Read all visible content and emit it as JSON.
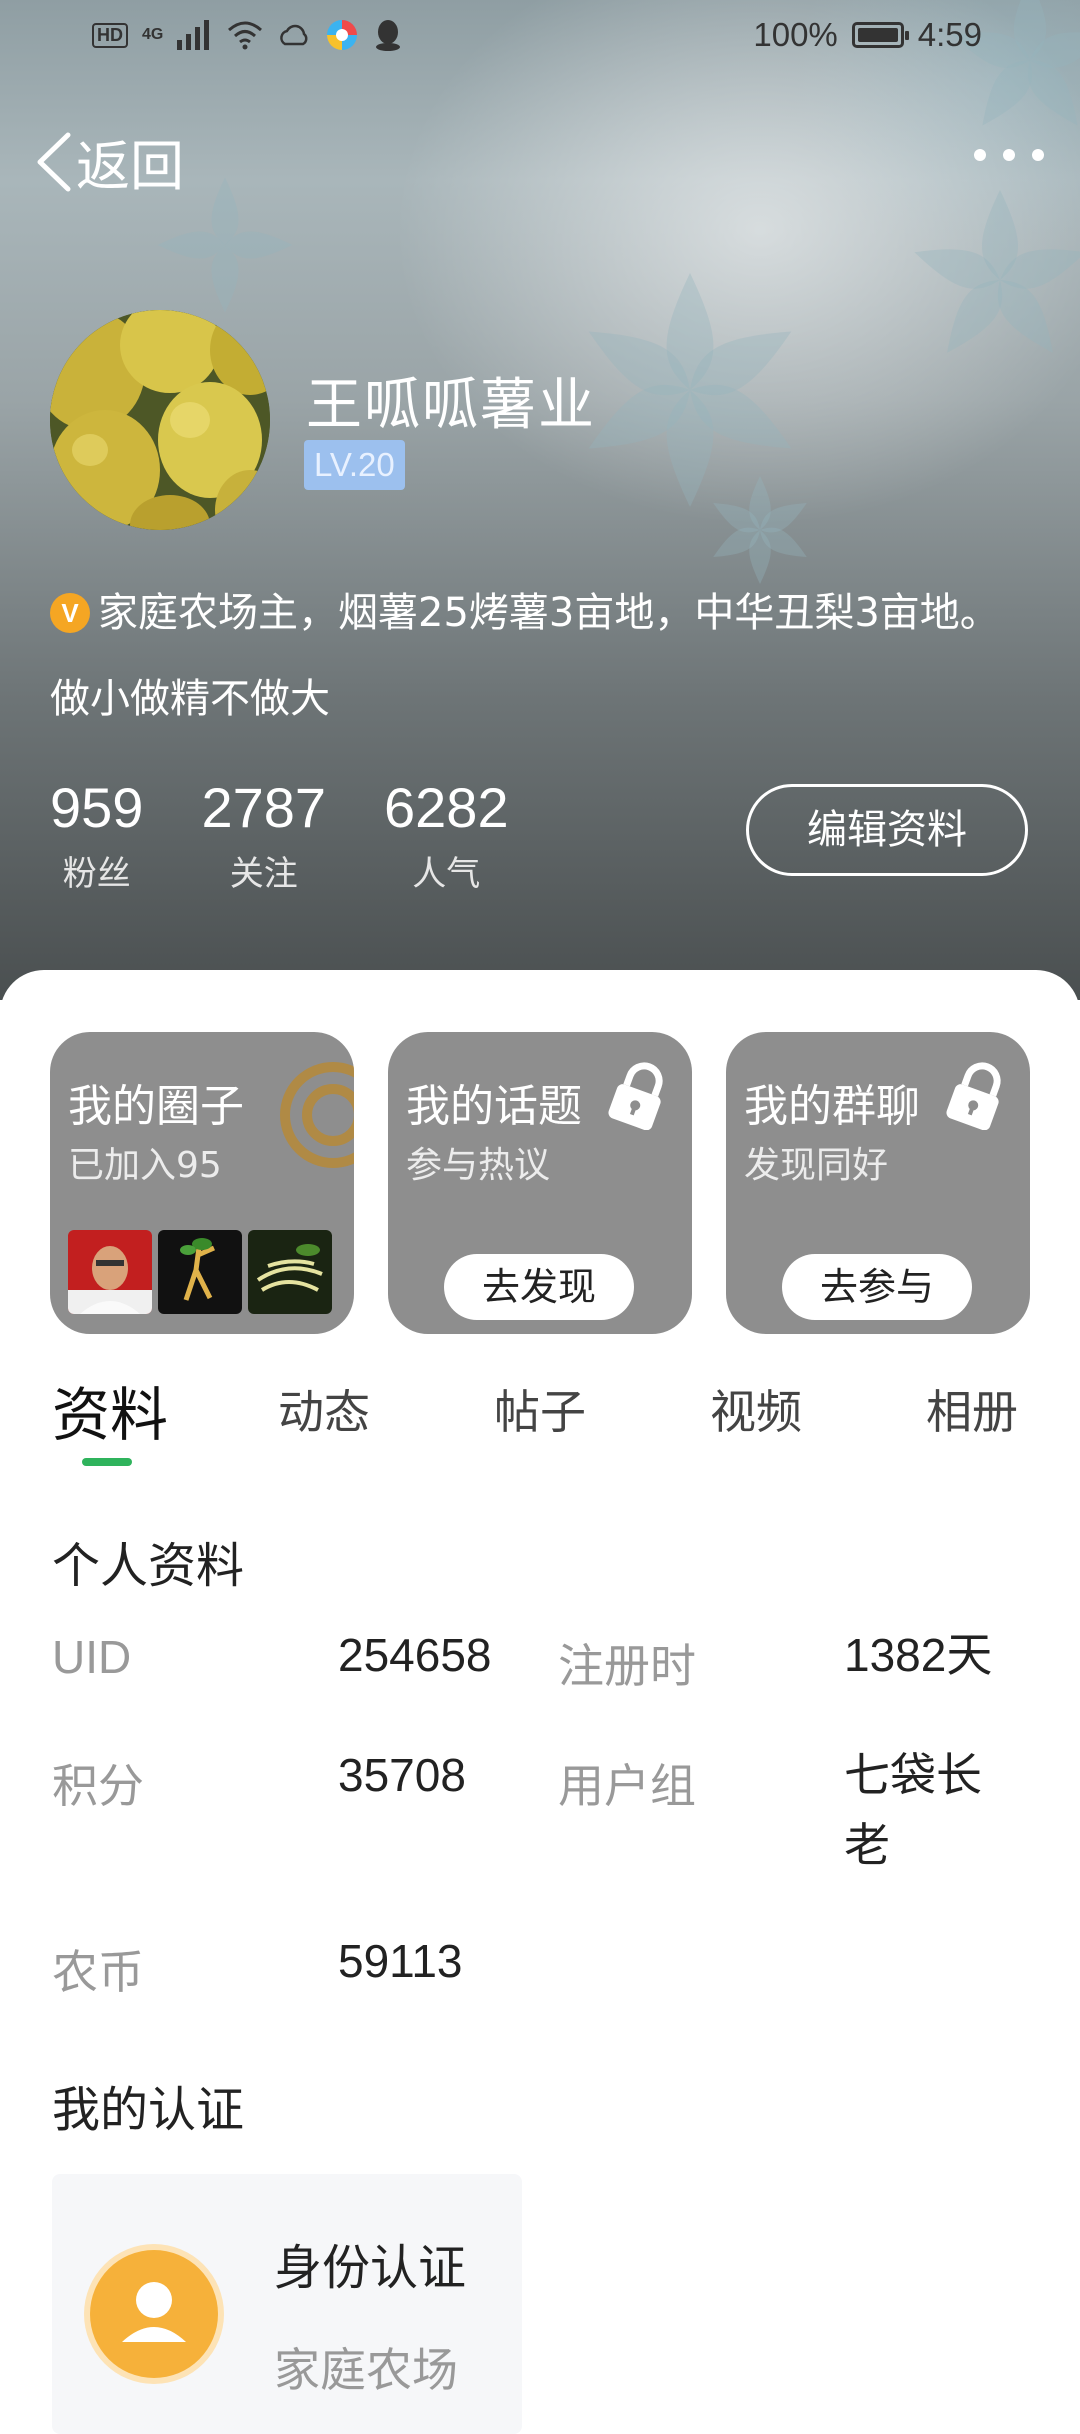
{
  "status_bar": {
    "network_left": "HD",
    "network_type": "4G",
    "battery": "100%",
    "battery_level": 1.0,
    "time": "4:59"
  },
  "nav": {
    "back_label": "返回",
    "back_icon": "chevron-left-icon",
    "more_icon": "more-dots-icon"
  },
  "profile": {
    "name": "王呱呱薯业",
    "level": "LV.20",
    "bio_line1": "家庭农场主，烟薯25烤薯3亩地，中华丑梨3亩地。",
    "bio_line2": "做小做精不做大",
    "verified_badge": "V",
    "stats": [
      {
        "value": "959",
        "label": "粉丝"
      },
      {
        "value": "2787",
        "label": "关注"
      },
      {
        "value": "6282",
        "label": "人气"
      }
    ],
    "edit_label": "编辑资料"
  },
  "cards": [
    {
      "title": "我的圈子",
      "subtitle": "已加入95",
      "icon": "circle-ring-icon"
    },
    {
      "title": "我的话题",
      "subtitle": "参与热议",
      "action": "去发现",
      "icon": "lock-icon"
    },
    {
      "title": "我的群聊",
      "subtitle": "发现同好",
      "action": "去参与",
      "icon": "lock-icon"
    }
  ],
  "tabs": [
    {
      "label": "资料",
      "active": true
    },
    {
      "label": "动态",
      "active": false
    },
    {
      "label": "帖子",
      "active": false
    },
    {
      "label": "视频",
      "active": false
    },
    {
      "label": "相册",
      "active": false
    }
  ],
  "personal_info": {
    "title": "个人资料",
    "rows": [
      {
        "key": "UID",
        "value": "254658"
      },
      {
        "key": "注册时",
        "value": "1382天"
      },
      {
        "key": "积分",
        "value": "35708"
      },
      {
        "key": "用户组",
        "value_line1": "七袋长",
        "value_line2": "老"
      },
      {
        "key": "农币",
        "value": "59113"
      }
    ]
  },
  "certification": {
    "title": "我的认证",
    "card_title": "身份认证",
    "card_sub": "家庭农场",
    "icon": "user-icon"
  },
  "colors": {
    "accent_green": "#2fb35c",
    "badge_blue": "#9cc0ee",
    "verified_orange": "#f5a623",
    "card_gray": "#8e8e8e"
  }
}
